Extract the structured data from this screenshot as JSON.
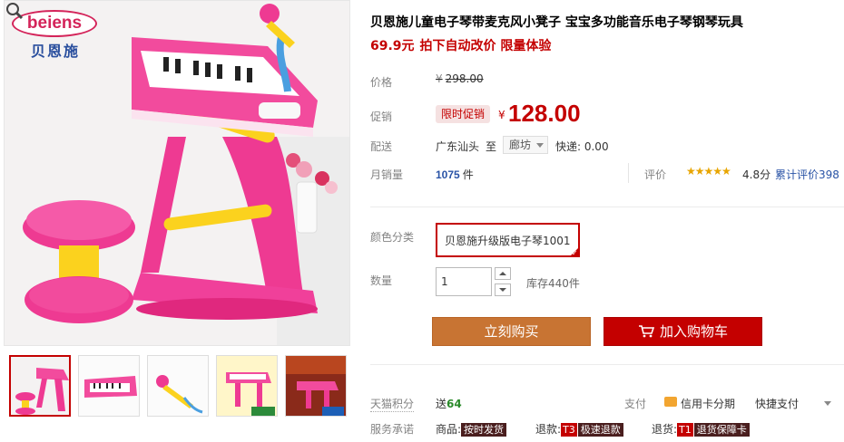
{
  "brand": {
    "logo_text": "beiens",
    "logo_cn": "贝恩施"
  },
  "product": {
    "title": "贝恩施儿童电子琴带麦克风小凳子 宝宝多功能音乐电子琴钢琴玩具",
    "subtitle_price": "69.9元",
    "subtitle_text": "拍下自动改价 限量体验"
  },
  "price": {
    "label": "价格",
    "currency": "¥",
    "original": "298.00",
    "promo_label": "促销",
    "promo_badge": "限时促销",
    "promo_currency": "¥",
    "promo_price": "128.00"
  },
  "shipping": {
    "label": "配送",
    "from": "广东汕头",
    "to_label": "至",
    "destination": "廊坊",
    "fee": "快递: 0.00"
  },
  "sales": {
    "label": "月销量",
    "count": "1075",
    "unit": "件",
    "review_label": "评价",
    "stars": "★★★★★",
    "score": "4.8分",
    "review_count": "累计评价398"
  },
  "color": {
    "label": "颜色分类",
    "selected": "贝恩施升级版电子琴1001"
  },
  "quantity": {
    "label": "数量",
    "value": "1",
    "stock": "库存440件"
  },
  "actions": {
    "buy_now": "立刻购买",
    "add_cart": "加入购物车"
  },
  "points": {
    "label": "天猫积分",
    "prefix": "送",
    "value": "64"
  },
  "payment": {
    "label": "支付",
    "credit": "信用卡分期",
    "quick": "快捷支付"
  },
  "service": {
    "label": "服务承诺",
    "items": [
      {
        "prefix": "商品:",
        "tag_t": "",
        "tag": "按时发货"
      },
      {
        "prefix": "退款:",
        "tag_t": "T3",
        "tag": "极速退款"
      },
      {
        "prefix": "退货:",
        "tag_t": "T1",
        "tag": "退货保障卡"
      }
    ]
  },
  "colors": {
    "accent": "#c40000",
    "buy_now": "#c87433",
    "link": "#2953a6",
    "star": "#e8a500"
  }
}
